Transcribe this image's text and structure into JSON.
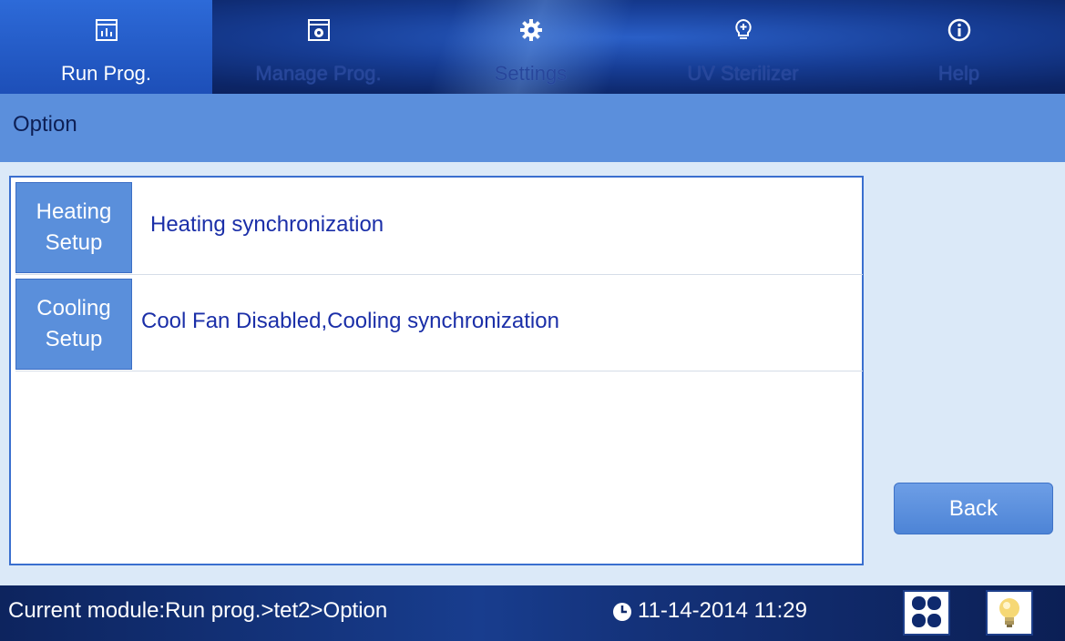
{
  "nav": {
    "tabs": [
      {
        "label": "Run Prog.",
        "icon": "chart-window-icon",
        "active": true
      },
      {
        "label": "Manage Prog.",
        "icon": "gear-window-icon",
        "active": false
      },
      {
        "label": "Settings",
        "icon": "gear-icon",
        "active": false
      },
      {
        "label": "UV Sterilizer",
        "icon": "lightbulb-plus-icon",
        "active": false
      },
      {
        "label": "Help",
        "icon": "info-icon",
        "active": false
      }
    ]
  },
  "title": "Option",
  "options": [
    {
      "label_line1": "Heating",
      "label_line2": "Setup",
      "value": "Heating synchronization"
    },
    {
      "label_line1": "Cooling",
      "label_line2": "Setup",
      "value": "Cool Fan Disabled,Cooling synchronization"
    }
  ],
  "back_label": "Back",
  "status": {
    "module": "Current module:Run prog.>tet2>Option",
    "datetime": "11-14-2014 11:29"
  },
  "colors": {
    "accent": "#5b8fdc",
    "nav_dark": "#0c2566",
    "value_text": "#1b2fa8"
  }
}
